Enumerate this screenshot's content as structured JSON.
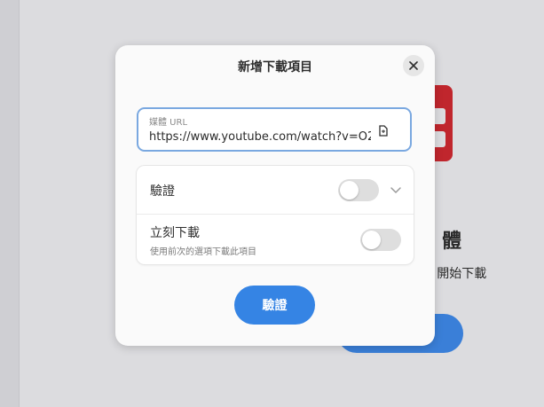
{
  "background": {
    "title_fragment": "體",
    "description_fragment": "URL 開始下載",
    "icon": "app-logo-icon"
  },
  "dialog": {
    "title": "新增下載項目",
    "close_icon": "close-icon",
    "url_field": {
      "label": "媒體 URL",
      "value": "https://www.youtube.com/watch?v=O2",
      "paste_icon": "paste-icon"
    },
    "options": [
      {
        "label": "驗證",
        "enabled": false,
        "expand_icon": "chevron-down-icon"
      },
      {
        "label": "立刻下載",
        "subtitle": "使用前次的選項下載此項目",
        "enabled": false
      }
    ],
    "primary_button": "驗證"
  },
  "colors": {
    "accent": "#3584e4",
    "focus_border": "#7aa8e0",
    "logo_red": "#c0262d"
  }
}
